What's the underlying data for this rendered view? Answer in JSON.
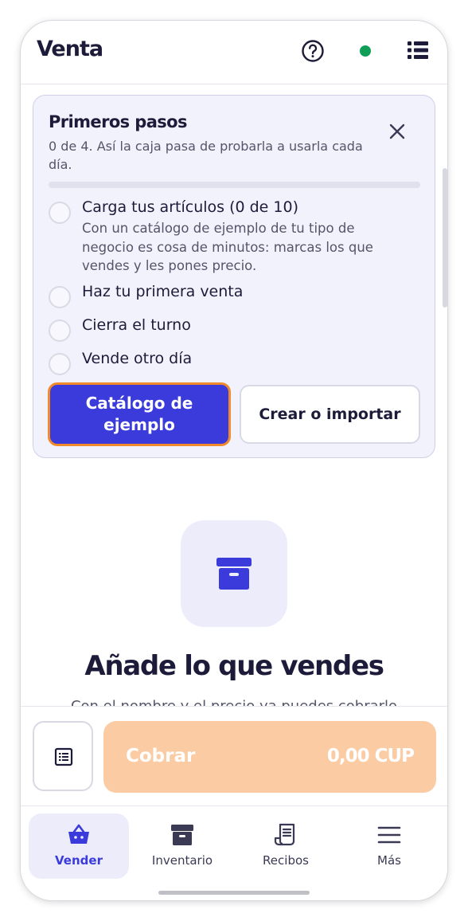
{
  "header": {
    "title": "Venta",
    "help_icon": "question-circle-icon",
    "status_color": "#0f9d58",
    "menu_icon": "list-icon"
  },
  "onboarding": {
    "title": "Primeros pasos",
    "subtitle": "0 de 4. Así la caja pasa de probarla a usarla cada día.",
    "progress_fraction": 0,
    "steps": [
      {
        "title": "Carga tus artículos (0 de 10)",
        "description": "Con un catálogo de ejemplo de tu tipo de negocio es cosa de minutos: marcas los que vendes y les pones precio."
      },
      {
        "title": "Haz tu primera venta"
      },
      {
        "title": "Cierra el turno"
      },
      {
        "title": "Vende otro día"
      }
    ],
    "primary_button": "Catálogo de ejemplo",
    "secondary_button": "Crear o importar"
  },
  "empty_state": {
    "icon": "archive-box-icon",
    "title": "Añade lo que vendes",
    "subtitle": "Con el nombre y el precio ya puedes cobrarlo"
  },
  "checkout": {
    "charge_label": "Cobrar",
    "amount": "0,00 CUP"
  },
  "nav": {
    "items": [
      {
        "label": "Vender",
        "icon": "basket-icon",
        "active": true
      },
      {
        "label": "Inventario",
        "icon": "archive-icon"
      },
      {
        "label": "Recibos",
        "icon": "receipt-icon"
      },
      {
        "label": "Más",
        "icon": "menu-icon"
      }
    ]
  },
  "colors": {
    "accent": "#3b3bdc",
    "focus_ring": "#f08a2a",
    "charge_disabled": "#fbcca4"
  }
}
